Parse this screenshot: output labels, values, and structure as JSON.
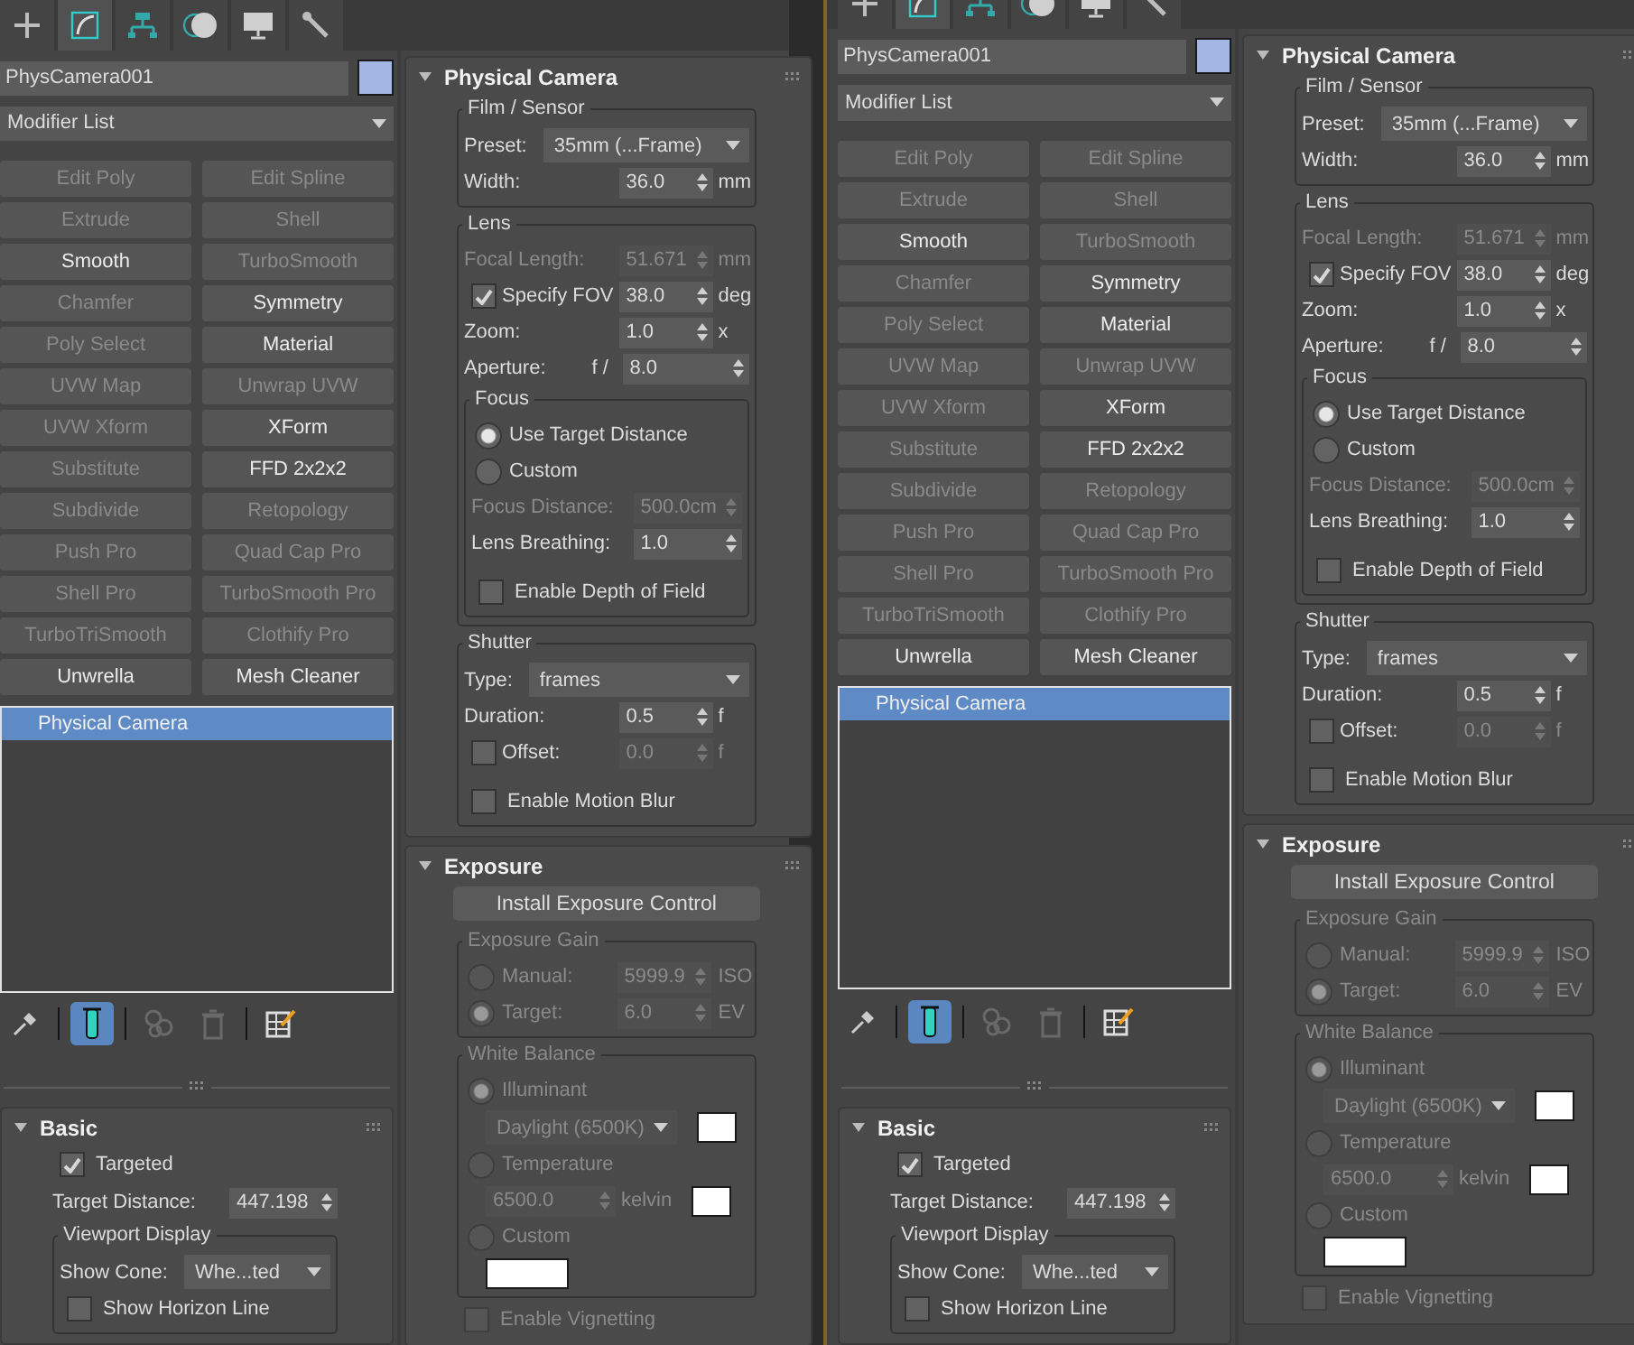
{
  "panels": [
    {
      "command_tabs": [
        {
          "selected": false
        },
        {
          "selected": true
        },
        {
          "selected": false
        },
        {
          "selected": false
        },
        {
          "selected": false
        },
        {
          "selected": false
        }
      ],
      "object_name": "PhysCamera001",
      "modifier_list": "Modifier List",
      "modifier_buttons": [
        {
          "label": "Edit Poly",
          "disabled": true
        },
        {
          "label": "Edit Spline",
          "disabled": true
        },
        {
          "label": "Extrude",
          "disabled": true
        },
        {
          "label": "Shell",
          "disabled": true
        },
        {
          "label": "Smooth",
          "disabled": false
        },
        {
          "label": "TurboSmooth",
          "disabled": true
        },
        {
          "label": "Chamfer",
          "disabled": true
        },
        {
          "label": "Symmetry",
          "disabled": false
        },
        {
          "label": "Poly Select",
          "disabled": true
        },
        {
          "label": "Material",
          "disabled": false
        },
        {
          "label": "UVW Map",
          "disabled": true
        },
        {
          "label": "Unwrap UVW",
          "disabled": true
        },
        {
          "label": "UVW Xform",
          "disabled": true
        },
        {
          "label": "XForm",
          "disabled": false
        },
        {
          "label": "Substitute",
          "disabled": true
        },
        {
          "label": "FFD 2x2x2",
          "disabled": false
        },
        {
          "label": "Subdivide",
          "disabled": true
        },
        {
          "label": "Retopology",
          "disabled": true
        },
        {
          "label": "Push Pro",
          "disabled": true
        },
        {
          "label": "Quad Cap Pro",
          "disabled": true
        },
        {
          "label": "Shell Pro",
          "disabled": true
        },
        {
          "label": "TurboSmooth Pro",
          "disabled": true
        },
        {
          "label": "TurboTriSmooth",
          "disabled": true
        },
        {
          "label": "Clothify Pro",
          "disabled": true
        },
        {
          "label": "Unwrella",
          "disabled": false
        },
        {
          "label": "Mesh Cleaner",
          "disabled": false
        }
      ],
      "stack": [
        {
          "label": "Physical Camera",
          "selected": true
        }
      ],
      "stack_tools": [
        {
          "on": false,
          "disabled": false
        },
        {
          "on": true,
          "disabled": false
        },
        {
          "on": false,
          "disabled": true
        },
        {
          "on": false,
          "disabled": true
        },
        {
          "on": false,
          "disabled": false
        }
      ],
      "basic": {
        "title": "Basic",
        "expanded": true,
        "rows": [
          {
            "kind": "checkbox",
            "label": "Targeted",
            "checked": true,
            "disabled": false
          },
          {
            "kind": "spinner",
            "label": "Target Distance:",
            "value": "447.198",
            "disabled": false
          },
          {
            "kind": "group",
            "title": "Viewport Display",
            "disabled": false,
            "rows": [
              {
                "kind": "dropdown",
                "label": "Show Cone:",
                "value": "Whe...ted",
                "disabled": false
              },
              {
                "kind": "checkbox",
                "label": "Show Horizon Line",
                "checked": false,
                "disabled": false
              }
            ]
          }
        ]
      },
      "rollouts": [
        {
          "title": "Physical Camera",
          "expanded": true,
          "rows": [
            {
              "kind": "group",
              "title": "Film / Sensor",
              "disabled": false,
              "rows": [
                {
                  "kind": "dropdown",
                  "label": "Preset:",
                  "value": "35mm (...Frame)",
                  "disabled": false
                },
                {
                  "kind": "spinner",
                  "label": "Width:",
                  "value": "36.0",
                  "unit": "mm",
                  "disabled": false
                }
              ]
            },
            {
              "kind": "group",
              "title": "Lens",
              "disabled": false,
              "rows": [
                {
                  "kind": "spinner",
                  "label": "Focal Length:",
                  "value": "51.671",
                  "unit": "mm",
                  "disabled": true
                },
                {
                  "kind": "spinner",
                  "label": "Specify FOV",
                  "checked": true,
                  "value": "38.0",
                  "unit": "deg",
                  "disabled": false
                },
                {
                  "kind": "spinner",
                  "label": "Zoom:",
                  "value": "1.0",
                  "unit": "x",
                  "disabled": false
                },
                {
                  "kind": "spinner",
                  "label": "Aperture:",
                  "prefix": "f /",
                  "value": "8.0",
                  "disabled": false
                },
                {
                  "kind": "group",
                  "title": "Focus",
                  "disabled": false,
                  "rows": [
                    {
                      "kind": "radio",
                      "label": "Use Target Distance",
                      "selected": true,
                      "disabled": false
                    },
                    {
                      "kind": "radio",
                      "label": "Custom",
                      "selected": false,
                      "disabled": false
                    },
                    {
                      "kind": "spinner",
                      "label": "Focus Distance:",
                      "value": "500.0cm",
                      "disabled": true
                    },
                    {
                      "kind": "spinner",
                      "label": "Lens Breathing:",
                      "value": "1.0",
                      "disabled": false
                    },
                    {
                      "kind": "checkbox",
                      "label": "Enable Depth of Field",
                      "checked": false,
                      "disabled": false
                    }
                  ]
                }
              ]
            },
            {
              "kind": "group",
              "title": "Shutter",
              "disabled": false,
              "rows": [
                {
                  "kind": "dropdown",
                  "label": "Type:",
                  "value": "frames",
                  "disabled": false
                },
                {
                  "kind": "spinner",
                  "label": "Duration:",
                  "value": "0.5",
                  "unit": "f",
                  "disabled": false
                },
                {
                  "kind": "spinner",
                  "label": "Offset:",
                  "checked": false,
                  "value": "0.0",
                  "unit": "f",
                  "disabled": true
                },
                {
                  "kind": "checkbox",
                  "label": "Enable Motion Blur",
                  "checked": false,
                  "disabled": false
                }
              ]
            }
          ]
        },
        {
          "title": "Exposure",
          "expanded": true,
          "rows": [
            {
              "kind": "button",
              "label": "Install Exposure Control"
            },
            {
              "kind": "group",
              "title": "Exposure Gain",
              "disabled": true,
              "rows": [
                {
                  "kind": "radio-spinner",
                  "label": "Manual:",
                  "selected": false,
                  "value": "5999.9",
                  "unit": "ISO",
                  "disabled": true
                },
                {
                  "kind": "radio-spinner",
                  "label": "Target:",
                  "selected": true,
                  "value": "6.0",
                  "unit": "EV",
                  "disabled": true
                }
              ]
            },
            {
              "kind": "group",
              "title": "White Balance",
              "disabled": true,
              "rows": [
                {
                  "kind": "radio",
                  "label": "Illuminant",
                  "selected": true,
                  "disabled": true
                },
                {
                  "kind": "dropdown-swatch",
                  "value": "Daylight (6500K)",
                  "disabled": true
                },
                {
                  "kind": "radio",
                  "label": "Temperature",
                  "selected": false,
                  "disabled": true
                },
                {
                  "kind": "spinner-swatch",
                  "value": "6500.0",
                  "unit": "kelvin",
                  "disabled": true
                },
                {
                  "kind": "radio",
                  "label": "Custom",
                  "selected": false,
                  "disabled": true
                },
                {
                  "kind": "swatch"
                }
              ]
            },
            {
              "kind": "checkbox",
              "label": "Enable Vignetting",
              "checked": false,
              "disabled": true
            }
          ]
        }
      ]
    },
    {
      "command_tabs": [
        {
          "selected": false
        },
        {
          "selected": true
        },
        {
          "selected": false
        },
        {
          "selected": false
        },
        {
          "selected": false
        },
        {
          "selected": false
        }
      ],
      "object_name": "PhysCamera001",
      "modifier_list": "Modifier List",
      "modifier_buttons": [
        {
          "label": "Edit Poly",
          "disabled": true
        },
        {
          "label": "Edit Spline",
          "disabled": true
        },
        {
          "label": "Extrude",
          "disabled": true
        },
        {
          "label": "Shell",
          "disabled": true
        },
        {
          "label": "Smooth",
          "disabled": false
        },
        {
          "label": "TurboSmooth",
          "disabled": true
        },
        {
          "label": "Chamfer",
          "disabled": true
        },
        {
          "label": "Symmetry",
          "disabled": false
        },
        {
          "label": "Poly Select",
          "disabled": true
        },
        {
          "label": "Material",
          "disabled": false
        },
        {
          "label": "UVW Map",
          "disabled": true
        },
        {
          "label": "Unwrap UVW",
          "disabled": true
        },
        {
          "label": "UVW Xform",
          "disabled": true
        },
        {
          "label": "XForm",
          "disabled": false
        },
        {
          "label": "Substitute",
          "disabled": true
        },
        {
          "label": "FFD 2x2x2",
          "disabled": false
        },
        {
          "label": "Subdivide",
          "disabled": true
        },
        {
          "label": "Retopology",
          "disabled": true
        },
        {
          "label": "Push Pro",
          "disabled": true
        },
        {
          "label": "Quad Cap Pro",
          "disabled": true
        },
        {
          "label": "Shell Pro",
          "disabled": true
        },
        {
          "label": "TurboSmooth Pro",
          "disabled": true
        },
        {
          "label": "TurboTriSmooth",
          "disabled": true
        },
        {
          "label": "Clothify Pro",
          "disabled": true
        },
        {
          "label": "Unwrella",
          "disabled": false
        },
        {
          "label": "Mesh Cleaner",
          "disabled": false
        }
      ],
      "stack": [
        {
          "label": "Physical Camera",
          "selected": true
        }
      ],
      "stack_tools": [
        {
          "on": false,
          "disabled": false
        },
        {
          "on": true,
          "disabled": false
        },
        {
          "on": false,
          "disabled": true
        },
        {
          "on": false,
          "disabled": true
        },
        {
          "on": false,
          "disabled": false
        }
      ],
      "basic": {
        "title": "Basic",
        "expanded": true,
        "rows": [
          {
            "kind": "checkbox",
            "label": "Targeted",
            "checked": true,
            "disabled": false
          },
          {
            "kind": "spinner",
            "label": "Target Distance:",
            "value": "447.198",
            "disabled": false
          },
          {
            "kind": "group",
            "title": "Viewport Display",
            "disabled": false,
            "rows": [
              {
                "kind": "dropdown",
                "label": "Show Cone:",
                "value": "Whe...ted",
                "disabled": false
              },
              {
                "kind": "checkbox",
                "label": "Show Horizon Line",
                "checked": false,
                "disabled": false
              }
            ]
          }
        ]
      },
      "rollouts": [
        {
          "title": "Physical Camera",
          "expanded": true,
          "rows": [
            {
              "kind": "group",
              "title": "Film / Sensor",
              "disabled": false,
              "rows": [
                {
                  "kind": "dropdown",
                  "label": "Preset:",
                  "value": "35mm (...Frame)",
                  "disabled": false
                },
                {
                  "kind": "spinner",
                  "label": "Width:",
                  "value": "36.0",
                  "unit": "mm",
                  "disabled": false
                }
              ]
            },
            {
              "kind": "group",
              "title": "Lens",
              "disabled": false,
              "rows": [
                {
                  "kind": "spinner",
                  "label": "Focal Length:",
                  "value": "51.671",
                  "unit": "mm",
                  "disabled": true
                },
                {
                  "kind": "spinner",
                  "label": "Specify FOV",
                  "checked": true,
                  "value": "38.0",
                  "unit": "deg",
                  "disabled": false
                },
                {
                  "kind": "spinner",
                  "label": "Zoom:",
                  "value": "1.0",
                  "unit": "x",
                  "disabled": false
                },
                {
                  "kind": "spinner",
                  "label": "Aperture:",
                  "prefix": "f /",
                  "value": "8.0",
                  "disabled": false
                },
                {
                  "kind": "group",
                  "title": "Focus",
                  "disabled": false,
                  "rows": [
                    {
                      "kind": "radio",
                      "label": "Use Target Distance",
                      "selected": true,
                      "disabled": false
                    },
                    {
                      "kind": "radio",
                      "label": "Custom",
                      "selected": false,
                      "disabled": false
                    },
                    {
                      "kind": "spinner",
                      "label": "Focus Distance:",
                      "value": "500.0cm",
                      "disabled": true
                    },
                    {
                      "kind": "spinner",
                      "label": "Lens Breathing:",
                      "value": "1.0",
                      "disabled": false
                    },
                    {
                      "kind": "checkbox",
                      "label": "Enable Depth of Field",
                      "checked": false,
                      "disabled": false
                    }
                  ]
                }
              ]
            },
            {
              "kind": "group",
              "title": "Shutter",
              "disabled": false,
              "rows": [
                {
                  "kind": "dropdown",
                  "label": "Type:",
                  "value": "frames",
                  "disabled": false
                },
                {
                  "kind": "spinner",
                  "label": "Duration:",
                  "value": "0.5",
                  "unit": "f",
                  "disabled": false
                },
                {
                  "kind": "spinner",
                  "label": "Offset:",
                  "checked": false,
                  "value": "0.0",
                  "unit": "f",
                  "disabled": true
                },
                {
                  "kind": "checkbox",
                  "label": "Enable Motion Blur",
                  "checked": false,
                  "disabled": false
                }
              ]
            }
          ]
        },
        {
          "title": "Exposure",
          "expanded": true,
          "rows": [
            {
              "kind": "button",
              "label": "Install Exposure Control"
            },
            {
              "kind": "group",
              "title": "Exposure Gain",
              "disabled": true,
              "rows": [
                {
                  "kind": "radio-spinner",
                  "label": "Manual:",
                  "selected": false,
                  "value": "5999.9",
                  "unit": "ISO",
                  "disabled": true
                },
                {
                  "kind": "radio-spinner",
                  "label": "Target:",
                  "selected": true,
                  "value": "6.0",
                  "unit": "EV",
                  "disabled": true
                }
              ]
            },
            {
              "kind": "group",
              "title": "White Balance",
              "disabled": true,
              "rows": [
                {
                  "kind": "radio",
                  "label": "Illuminant",
                  "selected": true,
                  "disabled": true
                },
                {
                  "kind": "dropdown-swatch",
                  "value": "Daylight (6500K)",
                  "disabled": true
                },
                {
                  "kind": "radio",
                  "label": "Temperature",
                  "selected": false,
                  "disabled": true
                },
                {
                  "kind": "spinner-swatch",
                  "value": "6500.0",
                  "unit": "kelvin",
                  "disabled": true
                },
                {
                  "kind": "radio",
                  "label": "Custom",
                  "selected": false,
                  "disabled": true
                },
                {
                  "kind": "swatch"
                }
              ]
            },
            {
              "kind": "checkbox",
              "label": "Enable Vignetting",
              "checked": false,
              "disabled": true
            }
          ]
        }
      ]
    }
  ]
}
